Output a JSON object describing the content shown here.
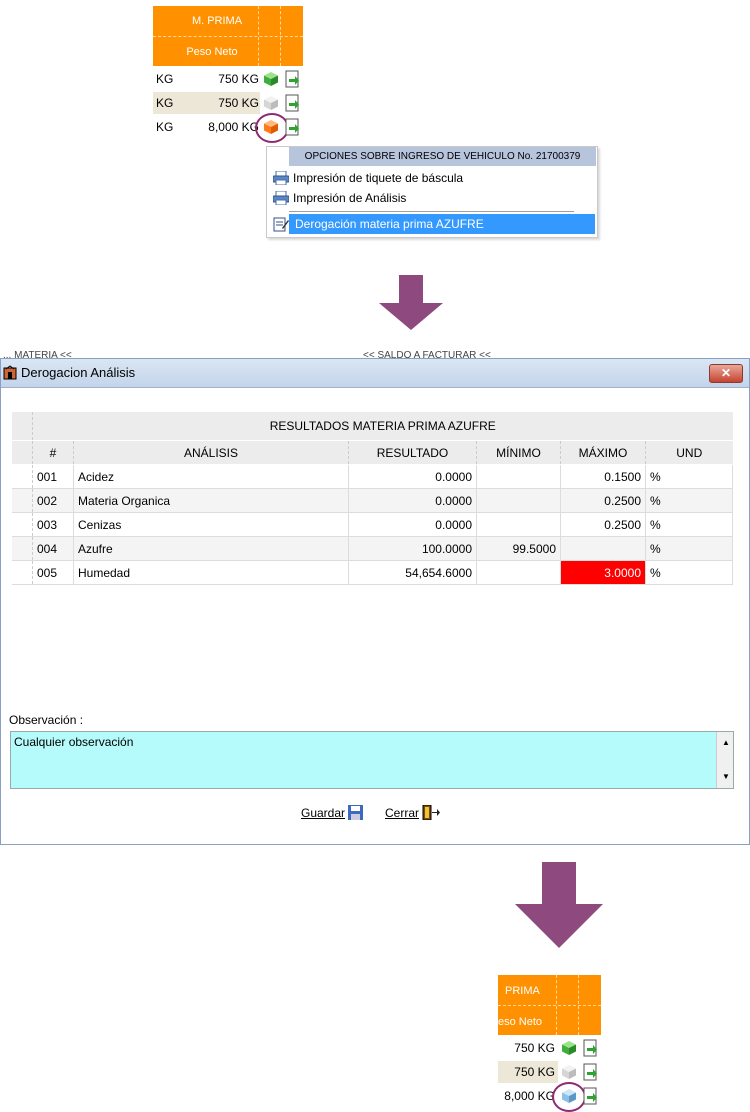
{
  "top_panel": {
    "header_title": "M. PRIMA",
    "header_sub": "Peso Neto",
    "rows": [
      {
        "unit": "KG",
        "weight": "750 KG",
        "status": "green-cube-icon"
      },
      {
        "unit": "KG",
        "weight": "750 KG",
        "status": "gray-cube-icon"
      },
      {
        "unit": "KG",
        "weight": "8,000 KG",
        "status": "orange-cube-icon"
      }
    ],
    "menu": {
      "title": "OPCIONES SOBRE INGRESO DE VEHICULO No. 21700379",
      "items": [
        {
          "label": "Impresión de tiquete de báscula",
          "icon": "printer-icon"
        },
        {
          "label": "Impresión de Análisis",
          "icon": "printer-icon"
        },
        {
          "label": "Derogación materia prima AZUFRE",
          "icon": "edit-document-icon",
          "selected": true
        }
      ]
    }
  },
  "dialog": {
    "title": "Derogacion Análisis",
    "bg_left": "... MATERIA << ",
    "bg_right": "<<  SALDO A FACTURAR  <<",
    "table_title": "RESULTADOS MATERIA PRIMA AZUFRE",
    "columns": [
      "#",
      "ANÁLISIS",
      "RESULTADO",
      "MÍNIMO",
      "MÁXIMO",
      "UND"
    ],
    "rows": [
      {
        "n": "001",
        "analisis": "Acidez",
        "resultado": "0.0000",
        "minimo": "",
        "maximo": "0.1500",
        "und": "%",
        "alert": false
      },
      {
        "n": "002",
        "analisis": "Materia Organica",
        "resultado": "0.0000",
        "minimo": "",
        "maximo": "0.2500",
        "und": "%",
        "alert": false
      },
      {
        "n": "003",
        "analisis": "Cenizas",
        "resultado": "0.0000",
        "minimo": "",
        "maximo": "0.2500",
        "und": "%",
        "alert": false
      },
      {
        "n": "004",
        "analisis": "Azufre",
        "resultado": "100.0000",
        "minimo": "99.5000",
        "maximo": "",
        "und": "%",
        "alert": false
      },
      {
        "n": "005",
        "analisis": "Humedad",
        "resultado": "54,654.6000",
        "minimo": "",
        "maximo": "3.0000",
        "und": "%",
        "alert": true
      }
    ],
    "observation_label": "Observación  :",
    "observation_value": "Cualquier observación",
    "save_label": "Guardar",
    "close_label": "Cerrar",
    "alert_color": "#ff0000"
  },
  "bottom_panel": {
    "header_title": "PRIMA",
    "header_sub": "eso Neto",
    "rows": [
      {
        "weight": "750 KG",
        "status": "green-cube-icon"
      },
      {
        "weight": "750 KG",
        "status": "gray-cube-icon"
      },
      {
        "weight": "8,000 KG",
        "status": "blue-cube-icon"
      }
    ]
  },
  "colors": {
    "header_orange": "#ff9100",
    "arrow": "#8e4a7e",
    "menu_selected": "#3399ff",
    "observation_bg": "#b6fbfb"
  }
}
